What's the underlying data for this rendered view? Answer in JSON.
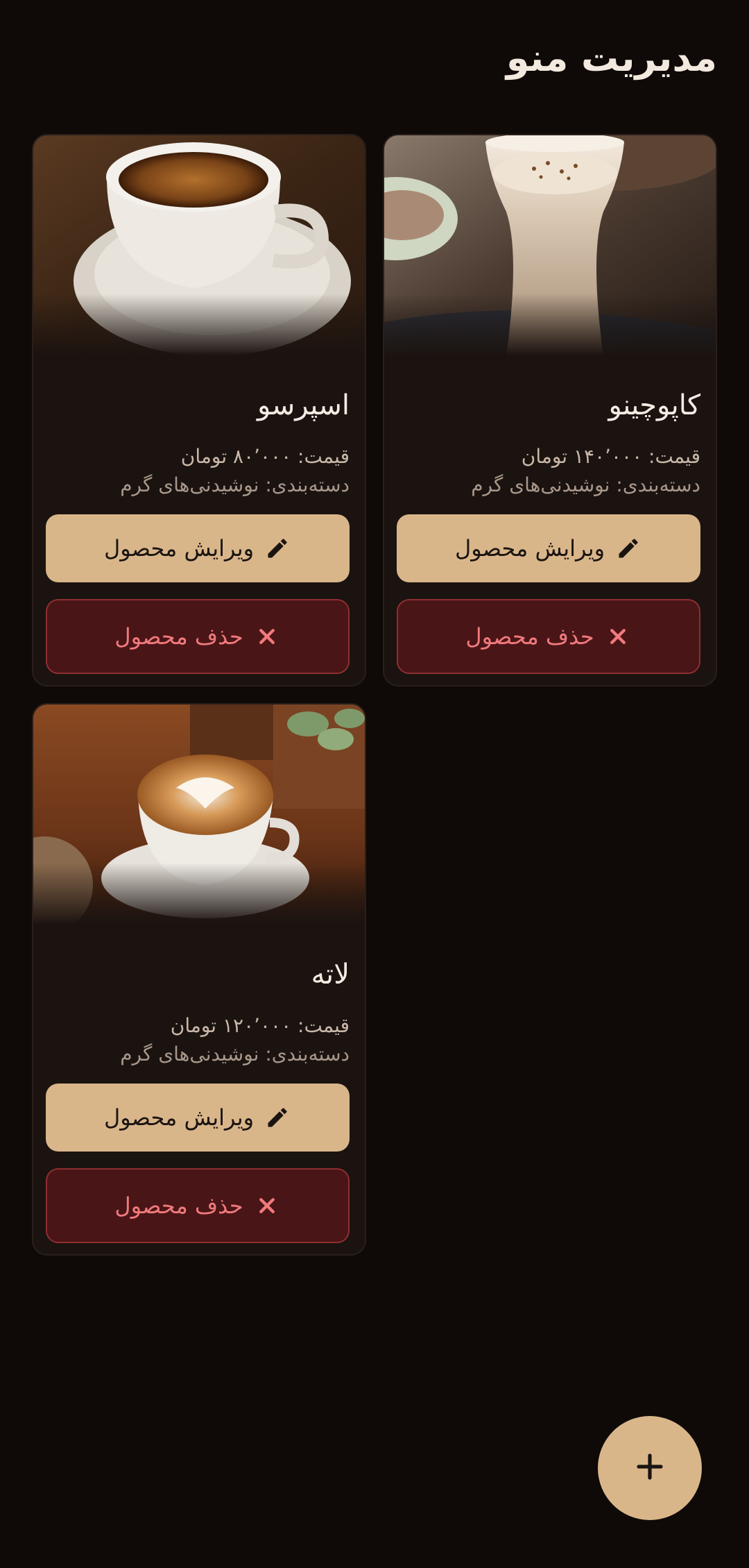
{
  "header": {
    "title": "مدیریت منو"
  },
  "products": [
    {
      "name": "اسپرسو",
      "price": "قیمت: ۸۰٬۰۰۰ تومان",
      "category": "دسته‌بندی: نوشیدنی‌های گرم",
      "edit_label": "ویرایش محصول",
      "delete_label": "حذف محصول",
      "image_icon": "espresso-image"
    },
    {
      "name": "کاپوچینو",
      "price": "قیمت: ۱۴۰٬۰۰۰ تومان",
      "category": "دسته‌بندی: نوشیدنی‌های گرم",
      "edit_label": "ویرایش محصول",
      "delete_label": "حذف محصول",
      "image_icon": "cappuccino-image"
    },
    {
      "name": "لاته",
      "price": "قیمت: ۱۲۰٬۰۰۰ تومان",
      "category": "دسته‌بندی: نوشیدنی‌های گرم",
      "edit_label": "ویرایش محصول",
      "delete_label": "حذف محصول",
      "image_icon": "latte-image"
    }
  ],
  "fab": {
    "icon": "plus-icon"
  },
  "colors": {
    "background": "#0f0a08",
    "card": "#1b1310",
    "accent": "#d9b68a",
    "danger_bg": "#4a1517",
    "danger_text": "#f07a7d"
  }
}
